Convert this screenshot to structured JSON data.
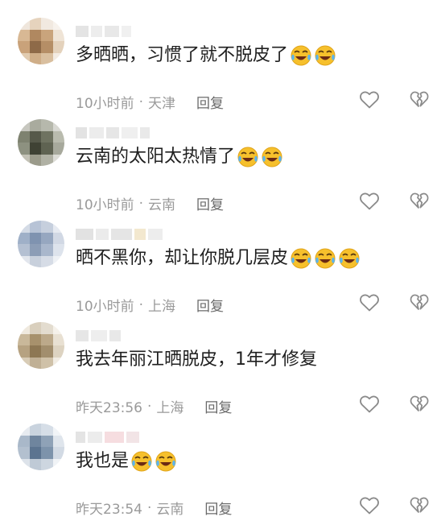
{
  "comments": [
    {
      "text": "多晒晒，习惯了就不脱皮了",
      "emoji_count": 2,
      "time": "10小时前",
      "separator": "·",
      "location": "天津",
      "reply_label": "回复"
    },
    {
      "text": "云南的太阳太热情了",
      "emoji_count": 2,
      "time": "10小时前",
      "separator": "·",
      "location": "云南",
      "reply_label": "回复"
    },
    {
      "text": "晒不黑你，却让你脱几层皮",
      "emoji_count": 3,
      "time": "10小时前",
      "separator": "·",
      "location": "上海",
      "reply_label": "回复"
    },
    {
      "text": "我去年丽江晒脱皮，1年才修复",
      "emoji_count": 0,
      "time": "昨天23:56",
      "separator": "·",
      "location": "上海",
      "reply_label": "回复"
    },
    {
      "text": "我也是",
      "emoji_count": 2,
      "time": "昨天23:54",
      "separator": "·",
      "location": "云南",
      "reply_label": "回复"
    }
  ],
  "icons": {
    "emoji": "laughing-tears-emoji-icon",
    "like": "heart-outline-icon",
    "dislike": "broken-heart-outline-icon"
  },
  "colors": {
    "meta_text": "#9a9a9a",
    "reply_text": "#6a6a6a",
    "icon_stroke": "#8a8a8a",
    "emoji_face": "#f6c02c"
  }
}
